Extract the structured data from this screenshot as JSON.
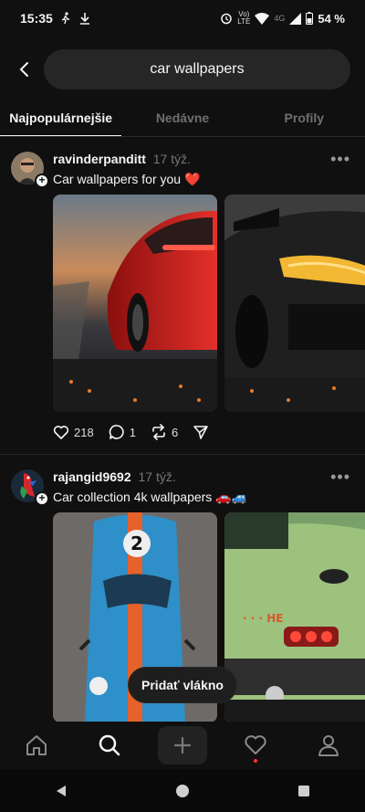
{
  "status_bar": {
    "time": "15:35",
    "network_top": "Vo)",
    "network_bottom": "LTE",
    "network_type": "4G",
    "battery": "54 %"
  },
  "search": {
    "query": "car wallpapers"
  },
  "tabs": [
    {
      "label": "Najpopulárnejšie",
      "active": true
    },
    {
      "label": "Nedávne",
      "active": false
    },
    {
      "label": "Profily",
      "active": false
    }
  ],
  "posts": [
    {
      "username": "ravinderpanditt",
      "time": "17 týž.",
      "caption": "Car wallpapers for you ❤️",
      "likes": "218",
      "replies": "1",
      "reposts": "6"
    },
    {
      "username": "rajangid9692",
      "time": "17 týž.",
      "caption": "Car collection 4k wallpapers 🚗🚙"
    }
  ],
  "toast": {
    "label": "Pridať vlákno"
  },
  "colors": {
    "background": "#101010",
    "accent_red": "#ff3040"
  },
  "bottom_nav": [
    "home-icon",
    "search-icon",
    "plus-icon",
    "heart-icon",
    "profile-icon"
  ]
}
